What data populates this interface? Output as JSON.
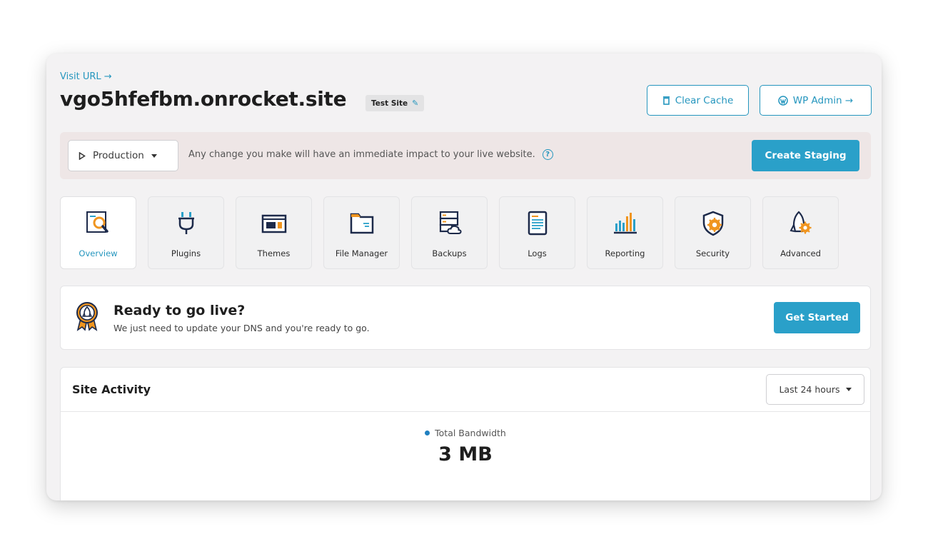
{
  "header": {
    "visit_url": "Visit URL →",
    "site_name": "vgo5hfefbm.onrocket.site",
    "badge": "Test Site",
    "clear_cache": "Clear Cache",
    "wp_admin": "WP Admin →"
  },
  "environment": {
    "selected": "Production",
    "message": "Any change you make will have an immediate impact to your live website.",
    "help": "?",
    "create_staging": "Create Staging"
  },
  "tabs": [
    {
      "label": "Overview",
      "icon": "overview-icon",
      "active": true
    },
    {
      "label": "Plugins",
      "icon": "plug-icon"
    },
    {
      "label": "Themes",
      "icon": "themes-icon"
    },
    {
      "label": "File Manager",
      "icon": "folder-icon"
    },
    {
      "label": "Backups",
      "icon": "backups-icon"
    },
    {
      "label": "Logs",
      "icon": "logs-icon"
    },
    {
      "label": "Reporting",
      "icon": "bar-chart-icon"
    },
    {
      "label": "Security",
      "icon": "shield-gear-icon"
    },
    {
      "label": "Advanced",
      "icon": "rocket-gear-icon"
    }
  ],
  "golive": {
    "title": "Ready to go live?",
    "subtitle": "We just need to update your DNS and you're ready to go.",
    "button": "Get Started"
  },
  "activity": {
    "title": "Site Activity",
    "range": "Last 24 hours",
    "legend": "Total Bandwidth",
    "value": "3 MB"
  },
  "colors": {
    "accent": "#2aa0c9",
    "orange": "#f0951f",
    "navy": "#1d2a4a"
  }
}
